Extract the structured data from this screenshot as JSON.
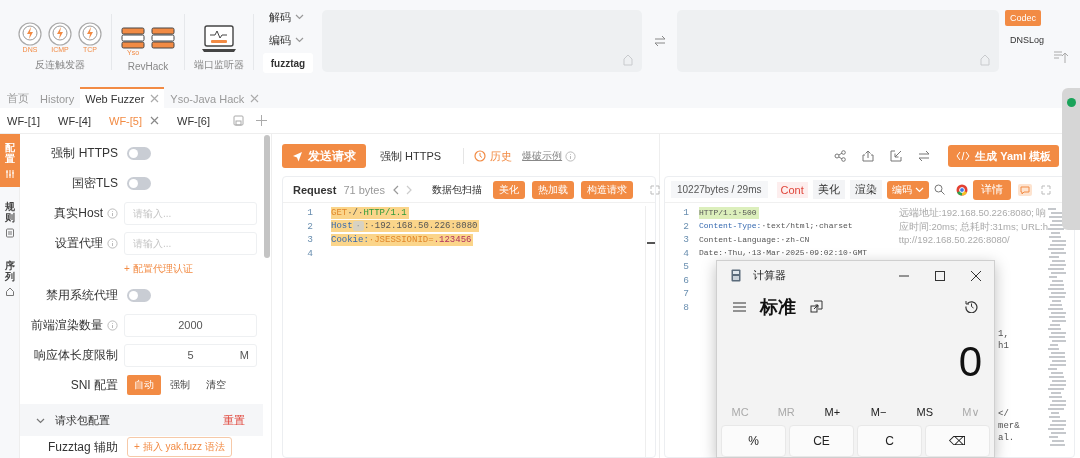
{
  "toolbar": {
    "groups": [
      {
        "label": "反连触发器",
        "items": [
          {
            "kind": "trigger",
            "caption": "DNS"
          },
          {
            "kind": "trigger",
            "caption": "ICMP"
          },
          {
            "kind": "trigger",
            "caption": "TCP"
          }
        ]
      },
      {
        "label": "RevHack",
        "items": [
          {
            "kind": "server",
            "caption": "Yso"
          },
          {
            "kind": "server"
          }
        ]
      },
      {
        "label": "端口监听器",
        "items": [
          {
            "kind": "monitor"
          }
        ]
      }
    ],
    "codec_menu": [
      {
        "label": "解码",
        "dropdown": true
      },
      {
        "label": "编码",
        "dropdown": true
      },
      {
        "label": "fuzztag",
        "dropdown": false
      }
    ],
    "side_buttons": [
      {
        "label": "Codec",
        "selected": true
      },
      {
        "label": "DNSLog",
        "selected": false
      }
    ]
  },
  "main_tabs": [
    {
      "label": "首页",
      "selected": false,
      "closable": false
    },
    {
      "label": "History",
      "selected": false,
      "closable": false
    },
    {
      "label": "Web Fuzzer",
      "selected": true,
      "closable": true
    },
    {
      "label": "Yso-Java Hack",
      "selected": false,
      "closable": true
    }
  ],
  "fuzzer_tabs": [
    {
      "label": "WF-[1]",
      "selected": false,
      "closable": false
    },
    {
      "label": "WF-[4]",
      "selected": false,
      "closable": false
    },
    {
      "label": "WF-[5]",
      "selected": true,
      "closable": true
    },
    {
      "label": "WF-[6]",
      "selected": false,
      "closable": false
    }
  ],
  "side_tabs": [
    {
      "label": "配置",
      "selected": true
    },
    {
      "label": "规则",
      "selected": false
    },
    {
      "label": "序列",
      "selected": false
    }
  ],
  "settings": [
    {
      "kind": "switch",
      "label": "强制 HTTPS",
      "on": false
    },
    {
      "kind": "switch",
      "label": "国密TLS",
      "on": false
    },
    {
      "kind": "input",
      "label": "真实Host",
      "info": true,
      "placeholder": "请输入..."
    },
    {
      "kind": "input",
      "label": "设置代理",
      "info": true,
      "placeholder": "请输入..."
    },
    {
      "kind": "link",
      "label": "+ 配置代理认证"
    },
    {
      "kind": "switch",
      "label": "禁用系统代理",
      "on": false
    },
    {
      "kind": "input",
      "label": "前端渲染数量",
      "info": true,
      "value": "2000"
    },
    {
      "kind": "input",
      "label": "响应体长度限制",
      "info": false,
      "value": "5",
      "suffix": "M"
    },
    {
      "kind": "segmented",
      "label": "SNI 配置",
      "options": [
        {
          "label": "自动",
          "selected": true
        },
        {
          "label": "强制",
          "selected": false
        },
        {
          "label": "清空",
          "selected": false
        }
      ]
    },
    {
      "kind": "section",
      "label": "请求包配置",
      "action": "重置",
      "expanded": true
    },
    {
      "kind": "button",
      "label": "Fuzztag 辅助",
      "button": "+ 插入 yak.fuzz 语法"
    }
  ],
  "request_bar": {
    "send": "发送请求",
    "force_https": "强制 HTTPS",
    "history": "历史",
    "example": "爆破示例"
  },
  "request": {
    "title": "Request",
    "size": "71 bytes",
    "scan": "数据包扫描",
    "actions": [
      "美化",
      "热加载",
      "构造请求"
    ],
    "lines": [
      {
        "number": "1",
        "highlighted": true,
        "tokens": [
          {
            "text": "GET",
            "kind": "keyword"
          },
          {
            "text": "·/·",
            "kind": "plain"
          },
          {
            "text": "HTTP/1.1",
            "kind": "version"
          }
        ]
      },
      {
        "number": "2",
        "highlighted": true,
        "tokens": [
          {
            "text": "Host",
            "kind": "header"
          },
          {
            "text": "·",
            "kind": "marker"
          },
          {
            "text": ":·192.168.50.226:8080",
            "kind": "plain"
          }
        ]
      },
      {
        "number": "3",
        "highlighted": true,
        "tokens": [
          {
            "text": "Cookie:",
            "kind": "header"
          },
          {
            "text": "·JSESSIONID=",
            "kind": "value"
          },
          {
            "text": ".123456",
            "kind": "number"
          }
        ]
      },
      {
        "number": "4"
      }
    ]
  },
  "response_bar": {
    "yaml": "生成 Yaml 模板"
  },
  "response": {
    "stats": "10227bytes / 29ms",
    "tab": "Cont",
    "views": [
      "美化",
      "渲染"
    ],
    "encode": "编码",
    "detail": "详情",
    "lines": [
      {
        "number": "1",
        "highlighted": true,
        "tokens": [
          {
            "text": "HTTP/1.1·500",
            "kind": "plain"
          }
        ]
      },
      {
        "number": "2",
        "highlighted": false,
        "tokens": [
          {
            "text": "Content-Type:",
            "kind": "header"
          },
          {
            "text": "·text/html;·charset",
            "kind": "plain"
          }
        ]
      },
      {
        "number": "3",
        "highlighted": false,
        "tokens": [
          {
            "text": "Content-Language:·zh-CN",
            "kind": "plain"
          }
        ]
      },
      {
        "number": "4",
        "highlighted": false,
        "tokens": [
          {
            "text": "Date:·Thu,·13·Mar·2025·09:02:10·GMT",
            "kind": "plain"
          }
        ]
      },
      {
        "number": "5"
      },
      {
        "number": "6"
      },
      {
        "number": "7"
      },
      {
        "number": "8"
      }
    ],
    "meta": [
      "远端地址:192.168.50.226:8080; 响",
      "应时间:20ms; 总耗时:31ms; URL:h",
      "ttp://192.168.50.226:8080/"
    ],
    "fragments": [
      "1,",
      "h1",
      "</",
      "mer&",
      "al."
    ]
  },
  "calculator": {
    "title": "计算器",
    "mode": "标准",
    "display": "0",
    "memory": [
      {
        "label": "MC",
        "disabled": true
      },
      {
        "label": "MR",
        "disabled": true
      },
      {
        "label": "M+",
        "disabled": false
      },
      {
        "label": "M−",
        "disabled": false
      },
      {
        "label": "MS",
        "disabled": false
      },
      {
        "label": "M∨",
        "disabled": true
      }
    ],
    "keys": [
      "%",
      "CE",
      "C",
      "⌫"
    ]
  }
}
